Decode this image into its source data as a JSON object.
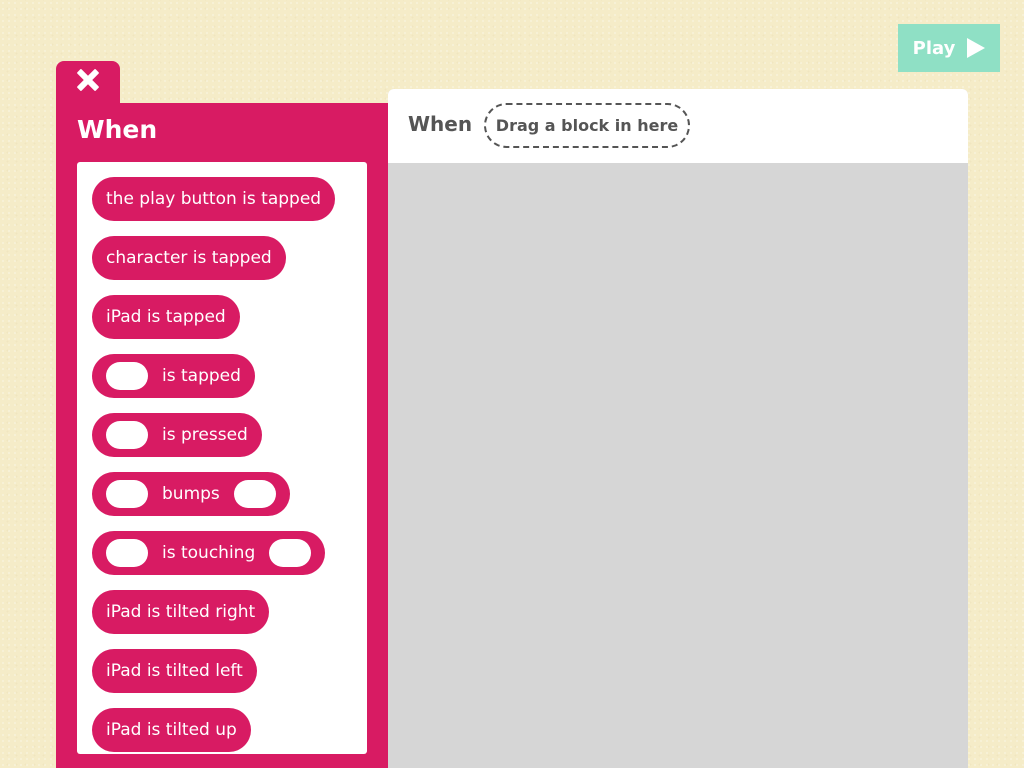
{
  "toolbar": {
    "play_label": "Play",
    "play_icon": "play-triangle-icon",
    "play_color": "#8fe0c5"
  },
  "palette": {
    "close_icon": "close-x-icon",
    "title": "When",
    "accent_color": "#d81b63",
    "blocks": [
      {
        "label": "the play button is tapped"
      },
      {
        "label": "character is tapped"
      },
      {
        "label": "iPad is tapped"
      },
      {
        "label": "is tapped"
      },
      {
        "label": "is pressed"
      },
      {
        "label": "bumps"
      },
      {
        "label": "is touching"
      },
      {
        "label": "iPad is tilted right"
      },
      {
        "label": "iPad is tilted left"
      },
      {
        "label": "iPad is tilted up"
      }
    ]
  },
  "script": {
    "when_label": "When",
    "drop_zone_label": "Drag a block in here"
  }
}
